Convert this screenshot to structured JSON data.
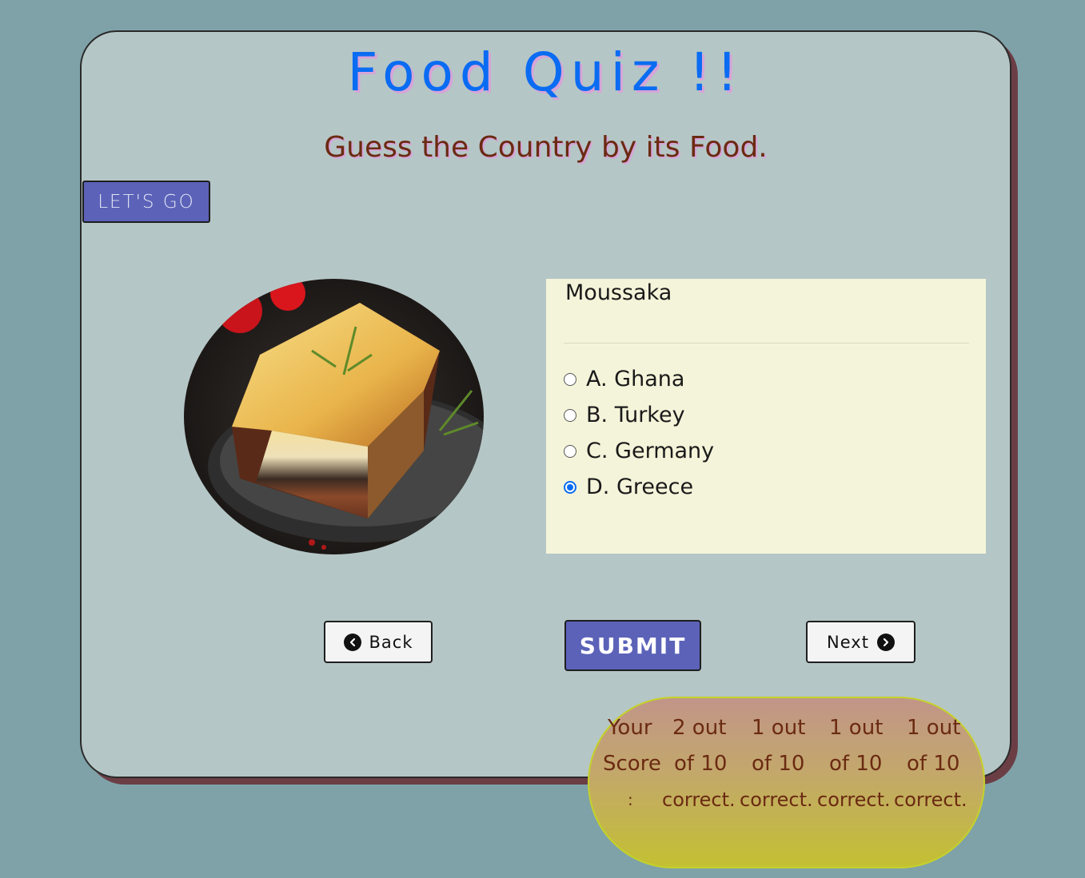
{
  "header": {
    "title": "Food Quiz !!",
    "subtitle": "Guess the Country by its Food."
  },
  "start_button": {
    "label": "LET'S GO"
  },
  "food_image": {
    "alt": "moussaka-photo"
  },
  "question": {
    "text": "Moussaka",
    "options": [
      {
        "letter": "A.",
        "label": "Ghana",
        "selected": false
      },
      {
        "letter": "B.",
        "label": "Turkey",
        "selected": false
      },
      {
        "letter": "C.",
        "label": "Germany",
        "selected": false
      },
      {
        "letter": "D.",
        "label": "Greece",
        "selected": true
      }
    ]
  },
  "controls": {
    "back_label": "Back",
    "submit_label": "SUBMIT",
    "next_label": "Next"
  },
  "score": {
    "label_line1": "Your",
    "label_line2": "Score",
    "label_colon": ":",
    "entries": [
      {
        "line1": "2 out",
        "line2": "of 10",
        "line3": "correct."
      },
      {
        "line1": "1 out",
        "line2": "of 10",
        "line3": "correct."
      },
      {
        "line1": "1 out",
        "line2": "of 10",
        "line3": "correct."
      },
      {
        "line1": "1 out",
        "line2": "of 10",
        "line3": "correct."
      }
    ]
  },
  "colors": {
    "background": "#7fa2a8",
    "card": "#b5c6c6",
    "title": "#0a6cf2",
    "subtitle": "#6b2a12",
    "button_primary": "#5b62b8",
    "question_box": "#f4f4da"
  },
  "icons": {
    "back": "chevron-left-circle-icon",
    "next": "chevron-right-circle-icon"
  }
}
